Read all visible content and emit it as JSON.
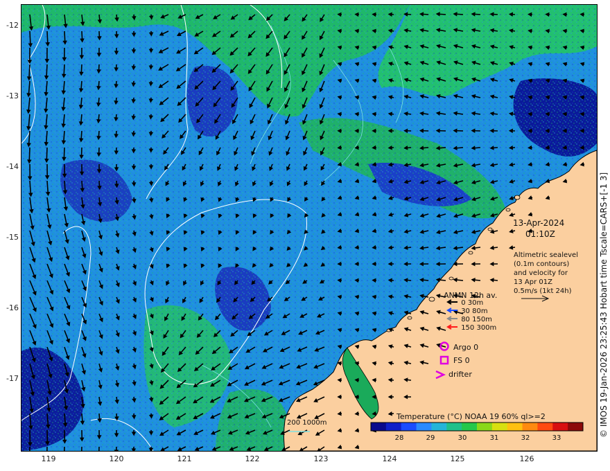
{
  "map": {
    "y_ticks": [
      "-12",
      "-13",
      "-14",
      "-15",
      "-16",
      "-17"
    ],
    "x_ticks": [
      "119",
      "120",
      "121",
      "122",
      "123",
      "124",
      "125",
      "126"
    ],
    "lon_range": [
      118.6,
      126.9
    ],
    "lat_range": [
      -11.7,
      -17.95
    ]
  },
  "annotation": {
    "date": "13-Apr-2024",
    "time": "01:10Z",
    "altimetry_lines": [
      "Altimetric sealevel",
      "(0.1m contours)",
      "and velocity for",
      "13 Apr 01Z",
      "0.5m/s (1kt 24h)"
    ]
  },
  "legend": {
    "title": "ANMN 12h av.",
    "depth_bins": [
      {
        "label": "0 30m",
        "color": "#000000"
      },
      {
        "label": "30 80m",
        "color": "#1a4cff"
      },
      {
        "label": "80 150m",
        "color": "#8a8a8a"
      },
      {
        "label": "150 300m",
        "color": "#ff1a1a"
      }
    ],
    "argo": "Argo 0",
    "fs": "FS 0",
    "drifter": "drifter",
    "marker_color": "#e000e0"
  },
  "bathymetry": {
    "label": "200  1000m",
    "color": "#7fe0e0"
  },
  "colorbar": {
    "title": "Temperature (°C) NOAA 19 60% ql>=2",
    "ticks": [
      "28",
      "29",
      "30",
      "31",
      "32",
      "33"
    ],
    "range": [
      27.2,
      33.8
    ]
  },
  "copyright": "© IMOS 19-Jan-2026 23:25:43 Hobart time Tscale=CARS+[-1 3]",
  "colors": {
    "land": "#fbcf9f",
    "ocean_warm": "#1fc05a",
    "ocean_mid": "#1a78e6",
    "ocean_cool": "#0a1a9a"
  }
}
